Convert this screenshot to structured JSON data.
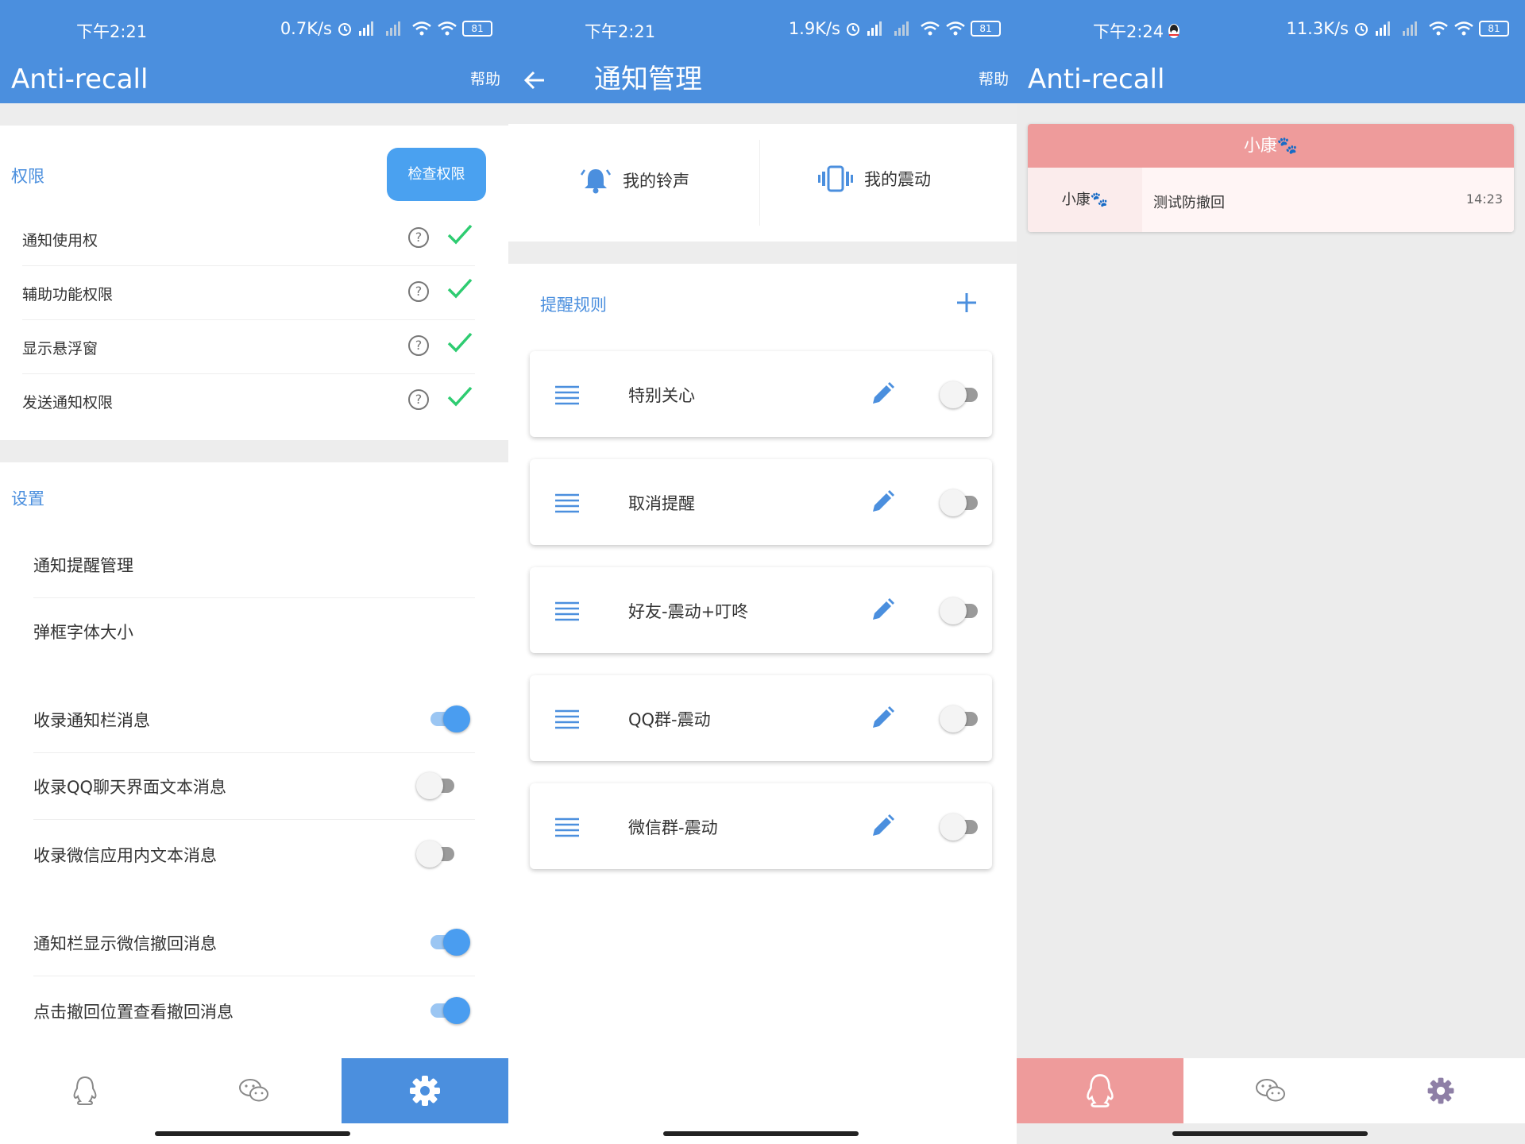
{
  "panel1": {
    "status": {
      "time": "下午2:21",
      "speed": "0.7K/s",
      "battery": "81"
    },
    "appbar": {
      "title": "Anti-recall",
      "help": "帮助"
    },
    "permissions": {
      "title": "权限",
      "check_button": "检查权限",
      "items": [
        {
          "label": "通知使用权",
          "help": "?"
        },
        {
          "label": "辅助功能权限",
          "help": "?"
        },
        {
          "label": "显示悬浮窗",
          "help": "?"
        },
        {
          "label": "发送通知权限",
          "help": "?"
        }
      ]
    },
    "settings": {
      "title": "设置",
      "items": [
        {
          "label": "通知提醒管理"
        },
        {
          "label": "弹框字体大小"
        },
        {
          "label": "收录通知栏消息",
          "enabled": true
        },
        {
          "label": "收录QQ聊天界面文本消息",
          "enabled": false
        },
        {
          "label": "收录微信应用内文本消息",
          "enabled": false
        },
        {
          "label": "通知栏显示微信撤回消息",
          "enabled": true
        },
        {
          "label": "点击撤回位置查看撤回消息",
          "enabled": true
        }
      ]
    },
    "nav": {
      "active": "settings"
    }
  },
  "panel2": {
    "status": {
      "time": "下午2:21",
      "speed": "1.9K/s",
      "battery": "81"
    },
    "appbar": {
      "title": "通知管理",
      "help": "帮助"
    },
    "media": {
      "ringtone": "我的铃声",
      "vibration": "我的震动"
    },
    "rules": {
      "title": "提醒规则",
      "items": [
        {
          "name": "特别关心",
          "enabled": false
        },
        {
          "name": "取消提醒",
          "enabled": false
        },
        {
          "name": "好友-震动+叮咚",
          "enabled": false
        },
        {
          "name": "QQ群-震动",
          "enabled": false
        },
        {
          "name": "微信群-震动",
          "enabled": false
        }
      ]
    }
  },
  "panel3": {
    "status": {
      "time": "下午2:24",
      "speed": "11.3K/s",
      "battery": "81"
    },
    "appbar": {
      "title": "Anti-recall"
    },
    "card": {
      "header": "小康🐾",
      "sender": "小康🐾",
      "message": "测试防撤回",
      "time": "14:23"
    },
    "nav": {
      "active": "qq"
    }
  },
  "colors": {
    "primary": "#4b8fde",
    "accent_pink": "#ee9b9b",
    "check_green": "#2ecc71"
  },
  "icons": [
    "alarm-icon",
    "signal-icon",
    "wifi-icon",
    "battery-icon",
    "back-arrow-icon",
    "help-circle-icon",
    "checkmark-icon",
    "bell-icon",
    "vibrate-icon",
    "plus-icon",
    "drag-menu-icon",
    "edit-pencil-icon",
    "qq-penguin-icon",
    "wechat-icon",
    "gear-icon",
    "qq-status-icon"
  ]
}
